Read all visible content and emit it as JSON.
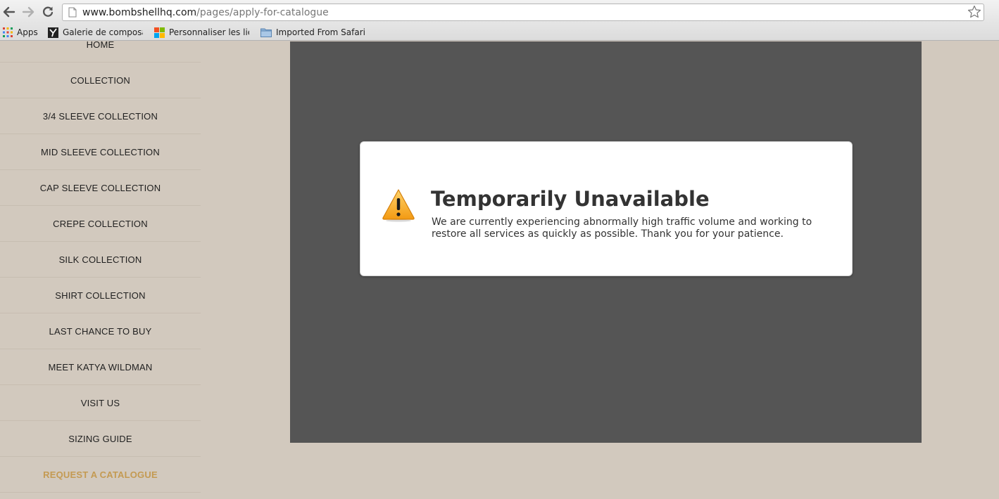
{
  "browser": {
    "url_host": "www.bombshellhq.com",
    "url_path": "/pages/apply-for-catalogue",
    "bookmarks": [
      {
        "label": "Apps",
        "icon": "apps-grid-icon"
      },
      {
        "label": "Galerie de composar",
        "icon": "bookmark-site-icon"
      },
      {
        "label": "Personnaliser les lien",
        "icon": "microsoft-logo-icon"
      },
      {
        "label": "Imported From Safari",
        "icon": "folder-icon"
      }
    ]
  },
  "sidebar": {
    "items": [
      {
        "label": "HOME"
      },
      {
        "label": "COLLECTION"
      },
      {
        "label": "3/4 SLEEVE COLLECTION"
      },
      {
        "label": "MID SLEEVE COLLECTION"
      },
      {
        "label": "CAP SLEEVE COLLECTION"
      },
      {
        "label": "CREPE COLLECTION"
      },
      {
        "label": "SILK COLLECTION"
      },
      {
        "label": "SHIRT COLLECTION"
      },
      {
        "label": "LAST CHANCE TO BUY"
      },
      {
        "label": "MEET KATYA WILDMAN"
      },
      {
        "label": "VISIT US"
      },
      {
        "label": "SIZING GUIDE"
      },
      {
        "label": "REQUEST A CATALOGUE",
        "active": true
      }
    ],
    "active_color": "#c49a52"
  },
  "dialog": {
    "title": "Temporarily Unavailable",
    "message": "We are currently experiencing abnormally high traffic volume and working to restore all services as quickly as possible. Thank you for your patience.",
    "icon": "warning-triangle-icon"
  }
}
